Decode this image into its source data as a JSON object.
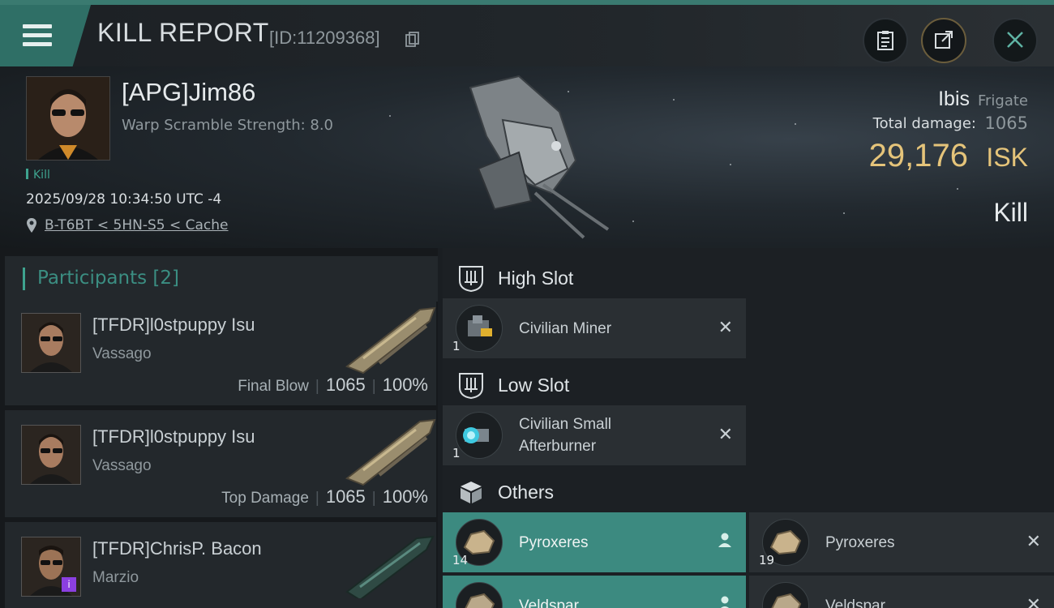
{
  "header": {
    "title": "KILL REPORT",
    "id_label": "[ID:11209368]"
  },
  "victim": {
    "name": "[APG]Jim86",
    "warp_scramble": "Warp Scramble Strength: 8.0",
    "tag": "Kill",
    "timestamp": "2025/09/28 10:34:50 UTC -4",
    "location": "B-T6BT < 5HN-S5 < Cache",
    "ship": "Ibis",
    "ship_class": "Frigate",
    "total_damage_label": "Total damage:",
    "total_damage": "1065",
    "isk_value": "29,176",
    "isk_unit": "ISK",
    "result": "Kill"
  },
  "participants": {
    "label": "Participants [2]",
    "items": [
      {
        "name": "[TFDR]l0stpuppy Isu",
        "ship": "Vassago",
        "role": "Final Blow",
        "damage": "1065",
        "percent": "100%"
      },
      {
        "name": "[TFDR]l0stpuppy Isu",
        "ship": "Vassago",
        "role": "Top Damage",
        "damage": "1065",
        "percent": "100%"
      },
      {
        "name": "[TFDR]ChrisP. Bacon",
        "ship": "Marzio"
      }
    ]
  },
  "fitting": {
    "high_slot": {
      "label": "High Slot",
      "items": [
        {
          "name": "Civilian Miner",
          "qty": "1"
        }
      ]
    },
    "low_slot": {
      "label": "Low Slot",
      "items": [
        {
          "name_line1": "Civilian Small",
          "name_line2": "Afterburner",
          "qty": "1"
        }
      ]
    },
    "others": {
      "label": "Others",
      "items": [
        {
          "name": "Pyroxeres",
          "qty": "14"
        },
        {
          "name": "Pyroxeres",
          "qty": "19"
        },
        {
          "name": "Veldspar",
          "qty": ""
        },
        {
          "name": "Veldspar",
          "qty": ""
        }
      ]
    }
  },
  "colors": {
    "accent": "#3ea38f",
    "isk": "#e5c47a",
    "selected_row": "#3c8a80"
  }
}
